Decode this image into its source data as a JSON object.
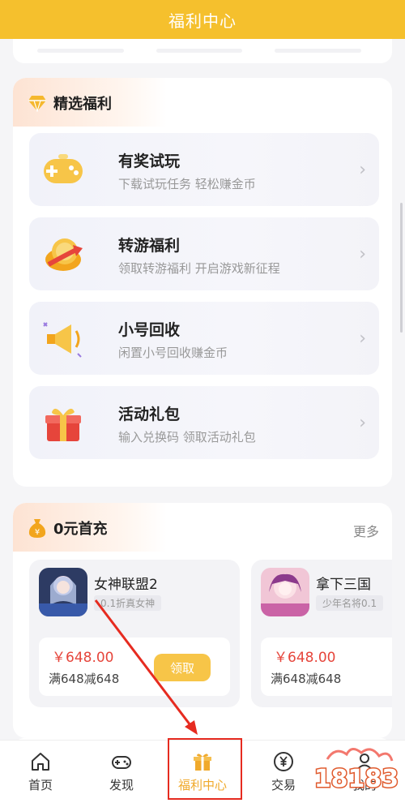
{
  "header": {
    "title": "福利中心"
  },
  "featured": {
    "title": "精选福利",
    "items": [
      {
        "name": "有奖试玩",
        "desc": "下载试玩任务 轻松赚金币",
        "icon": "gamepad-icon"
      },
      {
        "name": "转游福利",
        "desc": "领取转游福利 开启游戏新征程",
        "icon": "coin-arrow-icon"
      },
      {
        "name": "小号回收",
        "desc": "闲置小号回收赚金币",
        "icon": "megaphone-icon"
      },
      {
        "name": "活动礼包",
        "desc": "输入兑换码 领取活动礼包",
        "icon": "gift-box-icon"
      }
    ]
  },
  "recharge": {
    "title": "0元首充",
    "more": "更多",
    "games": [
      {
        "name": "女神联盟2",
        "tag": "0.1折真女神",
        "price": "￥648.00",
        "rule": "满648减648",
        "button": "领取"
      },
      {
        "name": "拿下三国",
        "tag": "少年名将0.1",
        "price": "￥648.00",
        "rule": "满648减648"
      }
    ]
  },
  "tabs": [
    {
      "label": "首页",
      "icon": "home-icon"
    },
    {
      "label": "发现",
      "icon": "gamepad-outline-icon"
    },
    {
      "label": "福利中心",
      "icon": "gift-icon",
      "active": true
    },
    {
      "label": "交易",
      "icon": "yen-circle-icon"
    },
    {
      "label": "我的",
      "icon": "user-icon"
    }
  ],
  "watermark": "18183",
  "colors": {
    "brand": "#f5c02d",
    "accent": "#f0a92b",
    "price": "#e6453b",
    "annotation": "#e62b20"
  }
}
